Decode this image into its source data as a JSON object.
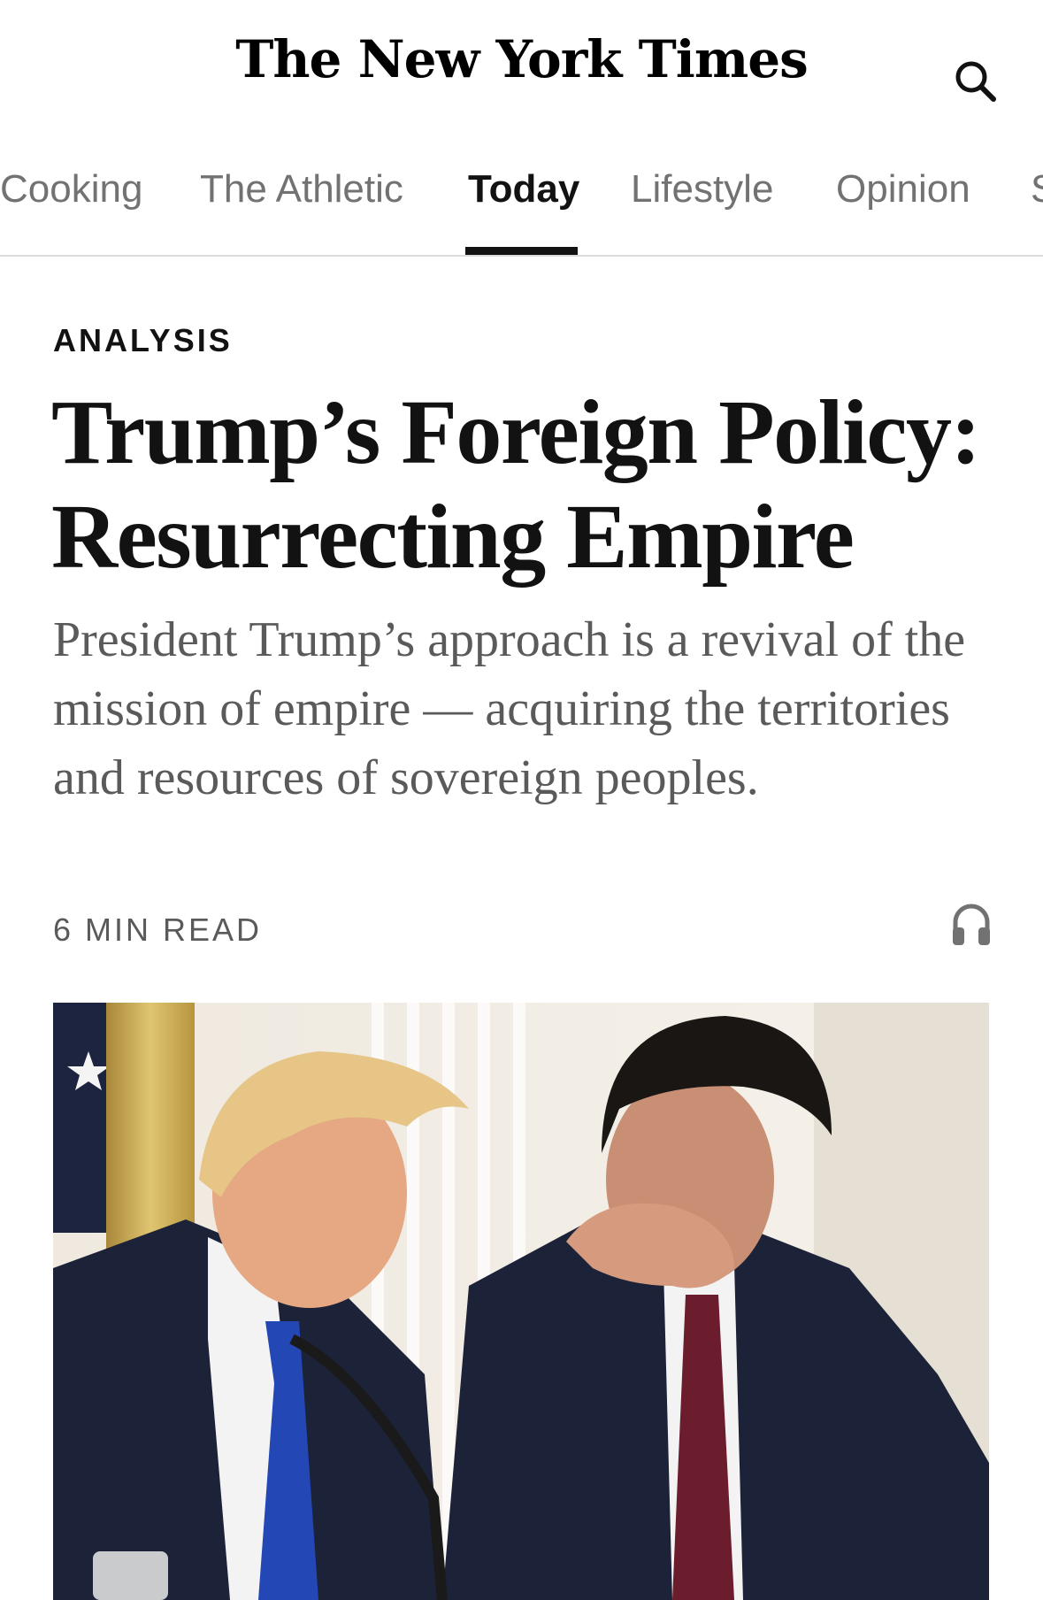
{
  "header": {
    "logo_text": "The New York Times",
    "search_icon": "search-icon"
  },
  "nav": {
    "items": [
      {
        "label": "Cooking"
      },
      {
        "label": "The Athletic"
      },
      {
        "label": "Today",
        "active": true
      },
      {
        "label": "Lifestyle"
      },
      {
        "label": "Opinion"
      },
      {
        "label": "S"
      }
    ]
  },
  "article": {
    "kicker": "ANALYSIS",
    "headline_line1": "Trump’s Foreign Policy:",
    "headline_line2": "Resurrecting Empire",
    "summary": "President Trump’s approach is a revival of the mission of empire — acquiring the territories and resources of sovereign peoples.",
    "read_time": "6 MIN READ",
    "listen_icon": "headphones-icon"
  },
  "colors": {
    "text": "#121212",
    "muted": "#727272",
    "summary": "#5a5a5a",
    "divider": "#dcdcdc"
  }
}
